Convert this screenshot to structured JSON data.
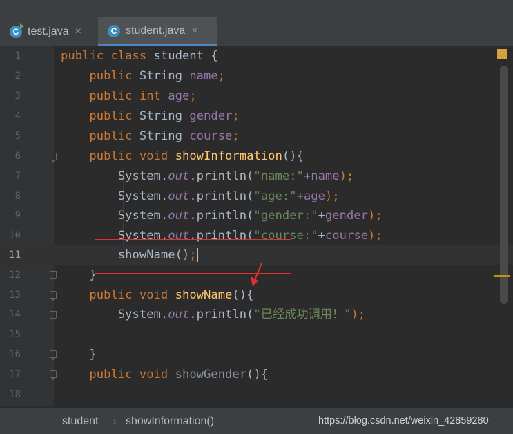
{
  "tabs": [
    {
      "label": "test.java",
      "icon": "java-class-run-icon",
      "close": "×"
    },
    {
      "label": "student.java",
      "icon": "java-class-icon",
      "close": "×"
    }
  ],
  "file_icon_letter": "C",
  "editor": {
    "lines": [
      {
        "num": "1"
      },
      {
        "num": "2"
      },
      {
        "num": "3"
      },
      {
        "num": "4"
      },
      {
        "num": "5"
      },
      {
        "num": "6"
      },
      {
        "num": "7"
      },
      {
        "num": "8"
      },
      {
        "num": "9"
      },
      {
        "num": "10"
      },
      {
        "num": "11"
      },
      {
        "num": "12"
      },
      {
        "num": "13"
      },
      {
        "num": "14"
      },
      {
        "num": "15"
      },
      {
        "num": "16"
      },
      {
        "num": "17"
      },
      {
        "num": "18"
      }
    ],
    "tokens": {
      "public": "public",
      "class": "class",
      "void": "void",
      "int": "int",
      "class_name": "student",
      "open_brace": " {",
      "close_brace": "}",
      "string_type": "String",
      "name": "name",
      "age": "age",
      "gender": "gender",
      "course": "course",
      "semicolon": ";",
      "system": "System.",
      "out": "out",
      "println": ".println(",
      "str_name": "\"name:\"",
      "str_age": "\"age:\"",
      "str_gender": "\"gender:\"",
      "str_course": "\"course:\"",
      "str_success": "\"已经成功调用！\"",
      "plus": "+",
      "close_call": ");",
      "show_information": "showInformation",
      "show_name": "showName",
      "show_gender": "showGender",
      "paren_brace": "(){",
      "call_parens": "()"
    },
    "current_line": "11"
  },
  "status": {
    "breadcrumb_class": "student",
    "breadcrumb_sep": "›",
    "breadcrumb_method": "showInformation()",
    "watermark": "https://blog.csdn.net/weixin_42859280"
  },
  "colors": {
    "background": "#2b2b2b",
    "keyword": "#cc7832",
    "field": "#9876aa",
    "string": "#6a8759",
    "method": "#ffc66d",
    "annotation_box": "#e03030",
    "tab_underline": "#4a88c7"
  }
}
